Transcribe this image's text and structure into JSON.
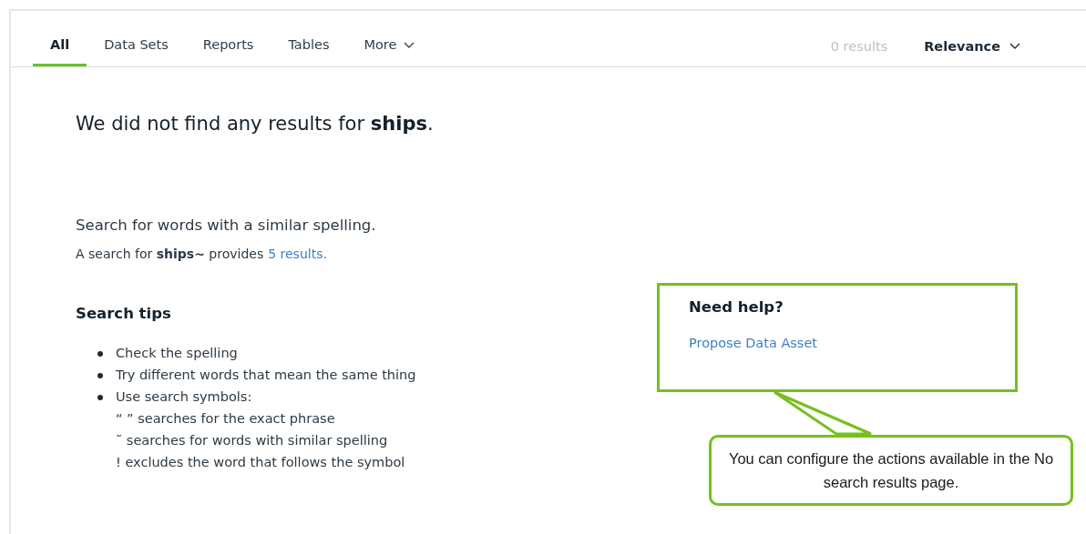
{
  "tabs": [
    {
      "label": "All",
      "selected": true
    },
    {
      "label": "Data Sets",
      "selected": false
    },
    {
      "label": "Reports",
      "selected": false
    },
    {
      "label": "Tables",
      "selected": false
    },
    {
      "label": "More",
      "selected": false,
      "kind": "dropdown"
    }
  ],
  "result_count": "0 results",
  "sort": {
    "label": "Relevance"
  },
  "heading": "We did not find any results for **ships**.",
  "suggestion": {
    "title": "Search for words with a similar spelling.",
    "text": "A search for **ships~** provides",
    "link": "5 results."
  },
  "tips": {
    "title": "Search tips",
    "items": [
      {
        "text": "Check the spelling"
      },
      {
        "text": "Try different words that mean the same thing"
      },
      {
        "text": "Use search symbols:",
        "children": [
          "“ ” searches for the exact phrase",
          "˜ searches for words with similar spelling",
          "! excludes the word that follows the symbol"
        ]
      }
    ]
  },
  "help": {
    "title": "Need help?",
    "link": "Propose Data Asset"
  },
  "annotation": {
    "text": "You can configure the actions available in the No search results page."
  }
}
